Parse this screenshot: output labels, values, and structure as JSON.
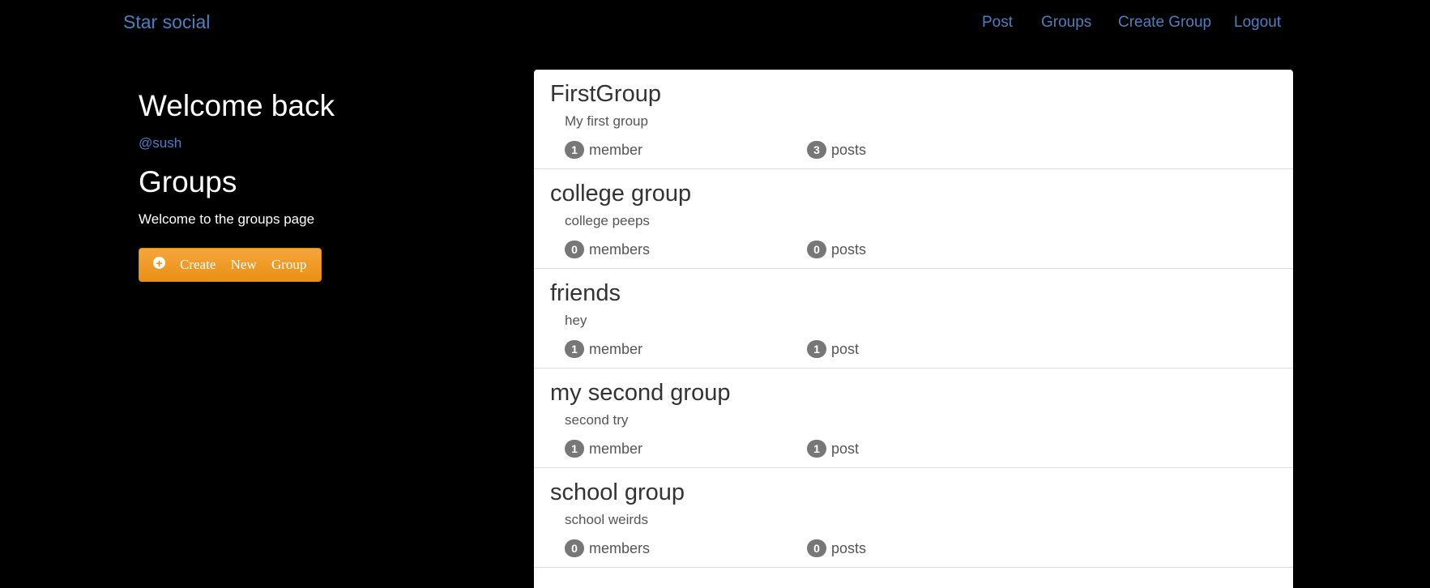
{
  "nav": {
    "brand": "Star social",
    "links": [
      "Post",
      "Groups",
      "Create Group",
      "Logout"
    ]
  },
  "sidebar": {
    "welcome": "Welcome back",
    "username": "@sush",
    "groups_title": "Groups",
    "groups_subtitle": "Welcome to the groups page",
    "create_button_label": "Create New Group",
    "create_button_icon": "plus-circle-icon"
  },
  "colors": {
    "background": "#000000",
    "link": "#4d7fc0",
    "button": "#f0a030",
    "badge": "#777777"
  },
  "groups": [
    {
      "name": "FirstGroup",
      "description": "My first group",
      "members_count": "1",
      "members_label": "member",
      "posts_count": "3",
      "posts_label": "posts"
    },
    {
      "name": "college group",
      "description": "college peeps",
      "members_count": "0",
      "members_label": "members",
      "posts_count": "0",
      "posts_label": "posts"
    },
    {
      "name": "friends",
      "description": "hey",
      "members_count": "1",
      "members_label": "member",
      "posts_count": "1",
      "posts_label": "post"
    },
    {
      "name": "my second group",
      "description": "second try",
      "members_count": "1",
      "members_label": "member",
      "posts_count": "1",
      "posts_label": "post"
    },
    {
      "name": "school group",
      "description": "school weirds",
      "members_count": "0",
      "members_label": "members",
      "posts_count": "0",
      "posts_label": "posts"
    }
  ]
}
